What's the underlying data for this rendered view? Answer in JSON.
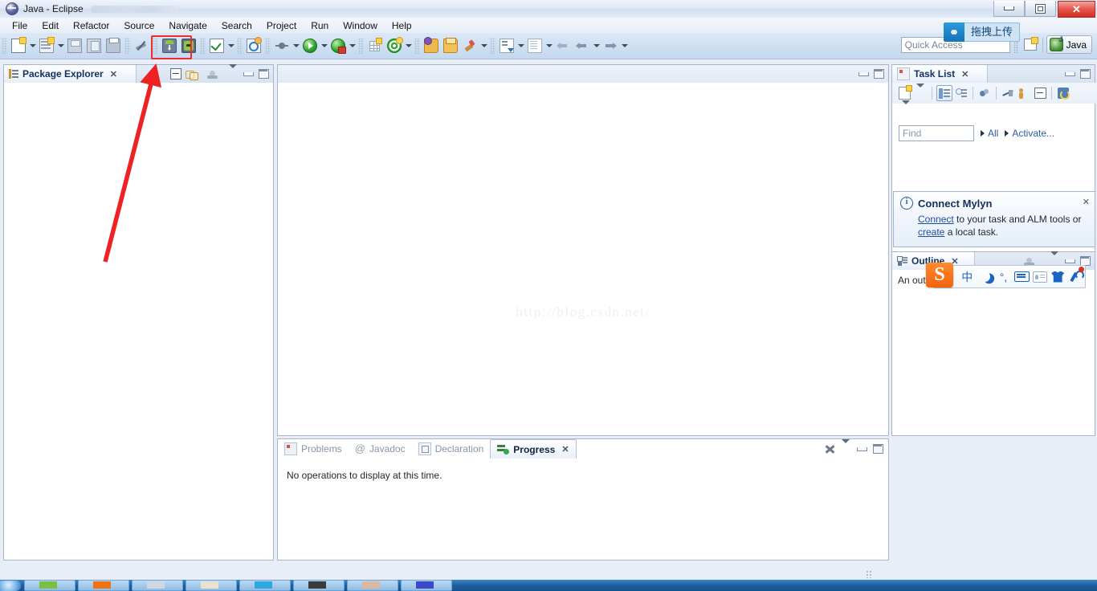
{
  "window": {
    "title": "Java - Eclipse",
    "app_icon": "eclipse-icon",
    "buttons": {
      "minimize": "minimize",
      "maximize": "maximize",
      "close": "✕"
    }
  },
  "menubar": {
    "items": [
      "File",
      "Edit",
      "Refactor",
      "Source",
      "Navigate",
      "Search",
      "Project",
      "Run",
      "Window",
      "Help"
    ]
  },
  "toolbar": {
    "groups": [
      {
        "name": "file",
        "buttons": [
          {
            "name": "new-button",
            "icon": "new-document-icon",
            "dropdown": true
          },
          {
            "name": "new-package-button",
            "icon": "new-java-package-icon",
            "dropdown": true
          },
          {
            "name": "save-button",
            "icon": "save-icon"
          },
          {
            "name": "save-all-button",
            "icon": "save-all-icon"
          },
          {
            "name": "print-button",
            "icon": "print-icon"
          }
        ]
      },
      {
        "name": "edit",
        "buttons": [
          {
            "name": "toggle-mark-occurrences-button",
            "icon": "no-edit-icon"
          }
        ]
      },
      {
        "name": "android",
        "highlighted": true,
        "buttons": [
          {
            "name": "android-virtual-device-manager-button",
            "icon": "android-download-icon"
          },
          {
            "name": "android-sdk-manager-button",
            "icon": "android-sdk-icon"
          }
        ]
      },
      {
        "name": "validate",
        "buttons": [
          {
            "name": "validate-button",
            "icon": "checkmark-icon",
            "dropdown": true
          }
        ]
      },
      {
        "name": "search",
        "buttons": [
          {
            "name": "open-search-dialog-button",
            "icon": "search-plus-icon"
          }
        ]
      },
      {
        "name": "debug",
        "buttons": [
          {
            "name": "debug-button",
            "icon": "debug-bug-icon",
            "dropdown": true
          },
          {
            "name": "run-button",
            "icon": "run-green-play-icon",
            "dropdown": true
          },
          {
            "name": "run-external-tools-button",
            "icon": "run-lock-icon",
            "dropdown": true
          }
        ]
      },
      {
        "name": "coverage",
        "buttons": [
          {
            "name": "new-android-activity-button",
            "icon": "grid-plus-icon"
          },
          {
            "name": "coverage-button",
            "icon": "target-icon",
            "dropdown": true
          }
        ]
      },
      {
        "name": "open",
        "buttons": [
          {
            "name": "open-type-button",
            "icon": "open-package-icon"
          },
          {
            "name": "open-task-button",
            "icon": "open-type-icon"
          },
          {
            "name": "skip-breakpoints-button",
            "icon": "brush-icon",
            "dropdown": true
          }
        ]
      },
      {
        "name": "annotation",
        "buttons": [
          {
            "name": "next-annotation-button",
            "icon": "next-annotation-icon",
            "dropdown": true
          },
          {
            "name": "last-edit-location-button",
            "icon": "last-edit-icon",
            "dropdown": true
          },
          {
            "name": "back-button",
            "icon": "back-arrow-icon"
          },
          {
            "name": "previous-button",
            "icon": "previous-arrow-icon",
            "dropdown": true
          },
          {
            "name": "forward-button",
            "icon": "forward-arrow-icon",
            "dropdown": true
          }
        ]
      }
    ]
  },
  "quick_access": {
    "placeholder": "Quick Access",
    "open_perspective_icon": "open-perspective-icon",
    "perspective_label": "Java",
    "perspective_icon": "java-perspective-icon"
  },
  "upload_tooltip": {
    "icon": "upload-cloud-icon",
    "text": "拖拽上传"
  },
  "package_explorer": {
    "tab_label": "Package Explorer",
    "tab_icon": "package-explorer-icon",
    "close_glyph": "✕",
    "tools": [
      {
        "name": "collapse-all-button",
        "icon": "collapse-all-icon"
      },
      {
        "name": "link-with-editor-button",
        "icon": "link-editor-icon"
      },
      {
        "name": "focus-on-active-task-button",
        "icon": "focus-task-icon"
      },
      {
        "name": "view-menu-button",
        "icon": "view-menu-icon"
      },
      {
        "name": "minimize-button",
        "icon": "minimize-icon"
      },
      {
        "name": "maximize-button",
        "icon": "maximize-icon"
      }
    ]
  },
  "editor": {
    "watermark": "http://blog.csdn.net/",
    "tools": [
      {
        "name": "minimize-button",
        "icon": "minimize-icon"
      },
      {
        "name": "maximize-button",
        "icon": "maximize-icon"
      }
    ]
  },
  "bottom_panel": {
    "tabs": [
      {
        "label": "Problems",
        "icon": "problems-icon",
        "active": false
      },
      {
        "label": "Javadoc",
        "icon": "javadoc-icon",
        "active": false
      },
      {
        "label": "Declaration",
        "icon": "declaration-icon",
        "active": false
      },
      {
        "label": "Progress",
        "icon": "progress-icon",
        "active": true,
        "close_glyph": "✕"
      }
    ],
    "message": "No operations to display at this time.",
    "tools": [
      {
        "name": "cancel-all-button",
        "icon": "kill-icon"
      },
      {
        "name": "view-menu-button",
        "icon": "view-menu-icon"
      },
      {
        "name": "minimize-button",
        "icon": "minimize-icon"
      },
      {
        "name": "maximize-button",
        "icon": "maximize-icon"
      }
    ]
  },
  "task_list": {
    "tab_label": "Task List",
    "tab_icon": "task-list-icon",
    "close_glyph": "✕",
    "tools": [
      {
        "name": "new-task-button",
        "icon": "new-task-icon"
      },
      {
        "name": "new-task-dropdown",
        "icon": "chevron-down-icon"
      },
      {
        "name": "categorized-view-button",
        "icon": "categorized-view-icon"
      },
      {
        "name": "scheduled-view-button",
        "icon": "scheduled-view-icon"
      },
      {
        "name": "presentation-button",
        "icon": "presentation-icon"
      },
      {
        "name": "focus-on-workweek-button",
        "icon": "focus-off-icon"
      },
      {
        "name": "show-my-tasks-button",
        "icon": "people-icon"
      },
      {
        "name": "collapse-all-button",
        "icon": "collapse-all-icon"
      },
      {
        "name": "synchronize-changed-button",
        "icon": "refresh-icon"
      },
      {
        "name": "view-menu-button",
        "icon": "view-menu-icon"
      }
    ],
    "window_tools": [
      {
        "name": "minimize-button",
        "icon": "minimize-icon"
      },
      {
        "name": "maximize-button",
        "icon": "maximize-icon"
      }
    ],
    "find": {
      "placeholder": "Find",
      "icon": "search-icon"
    },
    "filters": [
      {
        "label": "All",
        "icon": "triangle-right-icon"
      },
      {
        "label": "Activate...",
        "icon": "triangle-right-icon"
      }
    ]
  },
  "mylyn_popup": {
    "icon": "info-icon",
    "title": "Connect Mylyn",
    "close_glyph": "✕",
    "link_connect": "Connect",
    "text_1": " to your task and ALM tools or ",
    "link_create": "create",
    "text_2": " a local task."
  },
  "outline": {
    "tab_label": "Outline",
    "tab_icon": "outline-icon",
    "close_glyph": "✕",
    "body_text": "An outline",
    "tools": [
      {
        "name": "focus-button",
        "icon": "focus-task-icon"
      },
      {
        "name": "view-menu-button",
        "icon": "view-menu-icon"
      },
      {
        "name": "minimize-button",
        "icon": "minimize-icon"
      },
      {
        "name": "maximize-button",
        "icon": "maximize-icon"
      }
    ]
  },
  "ime_toolbar": {
    "logo": "S",
    "buttons": [
      {
        "name": "ime-chinese-mode-button",
        "label": "中"
      },
      {
        "name": "ime-moon-button",
        "icon": "moon-icon"
      },
      {
        "name": "ime-punctuation-button",
        "label": "°,"
      },
      {
        "name": "ime-soft-keyboard-button",
        "icon": "keyboard-icon"
      },
      {
        "name": "ime-contacts-button",
        "icon": "contact-card-icon"
      },
      {
        "name": "ime-skin-button",
        "icon": "shirt-icon"
      },
      {
        "name": "ime-settings-button",
        "icon": "wrench-icon",
        "badge": true
      }
    ]
  },
  "annotations": {
    "arrow_color": "#ee2222",
    "highlight_box_color": "#ef2b2b"
  }
}
